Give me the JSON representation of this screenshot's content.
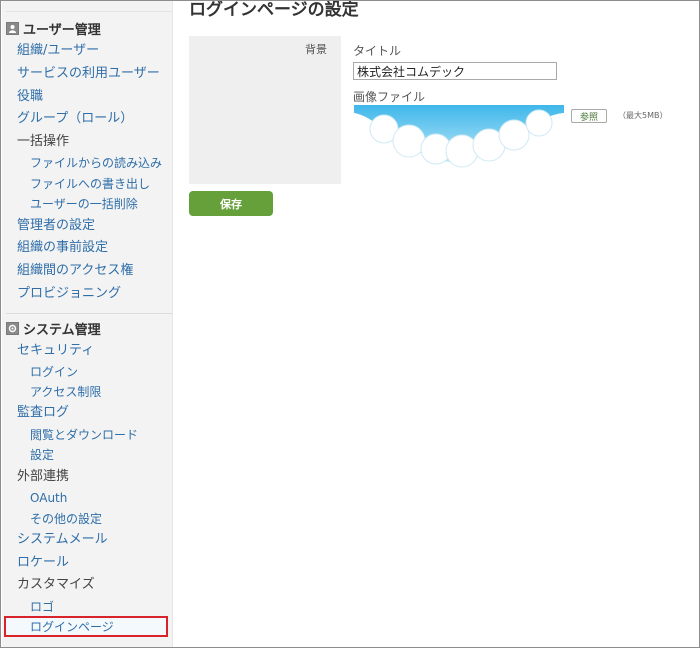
{
  "sidebar": {
    "user_mgmt": {
      "heading": "ユーザー管理",
      "items": [
        "組織/ユーザー",
        "サービスの利用ユーザー",
        "役職",
        "グループ（ロール）",
        "一括操作",
        "ファイルからの読み込み",
        "ファイルへの書き出し",
        "ユーザーの一括削除",
        "管理者の設定",
        "組織の事前設定",
        "組織間のアクセス権",
        "プロビジョニング"
      ]
    },
    "system_mgmt": {
      "heading": "システム管理",
      "items": [
        "セキュリティ",
        "ログイン",
        "アクセス制限",
        "監査ログ",
        "閲覧とダウンロード",
        "設定",
        "外部連携",
        "OAuth",
        "その他の設定",
        "システムメール",
        "ロケール",
        "カスタマイズ",
        "ロゴ",
        "ログインページ"
      ]
    }
  },
  "main": {
    "page_title": "ログインページの設定",
    "background_label": "背景",
    "title_label": "タイトル",
    "title_value": "株式会社コムデック",
    "image_label": "画像ファイル",
    "browse_label": "参照",
    "max_size": "（最大5MB）",
    "save_label": "保存"
  }
}
